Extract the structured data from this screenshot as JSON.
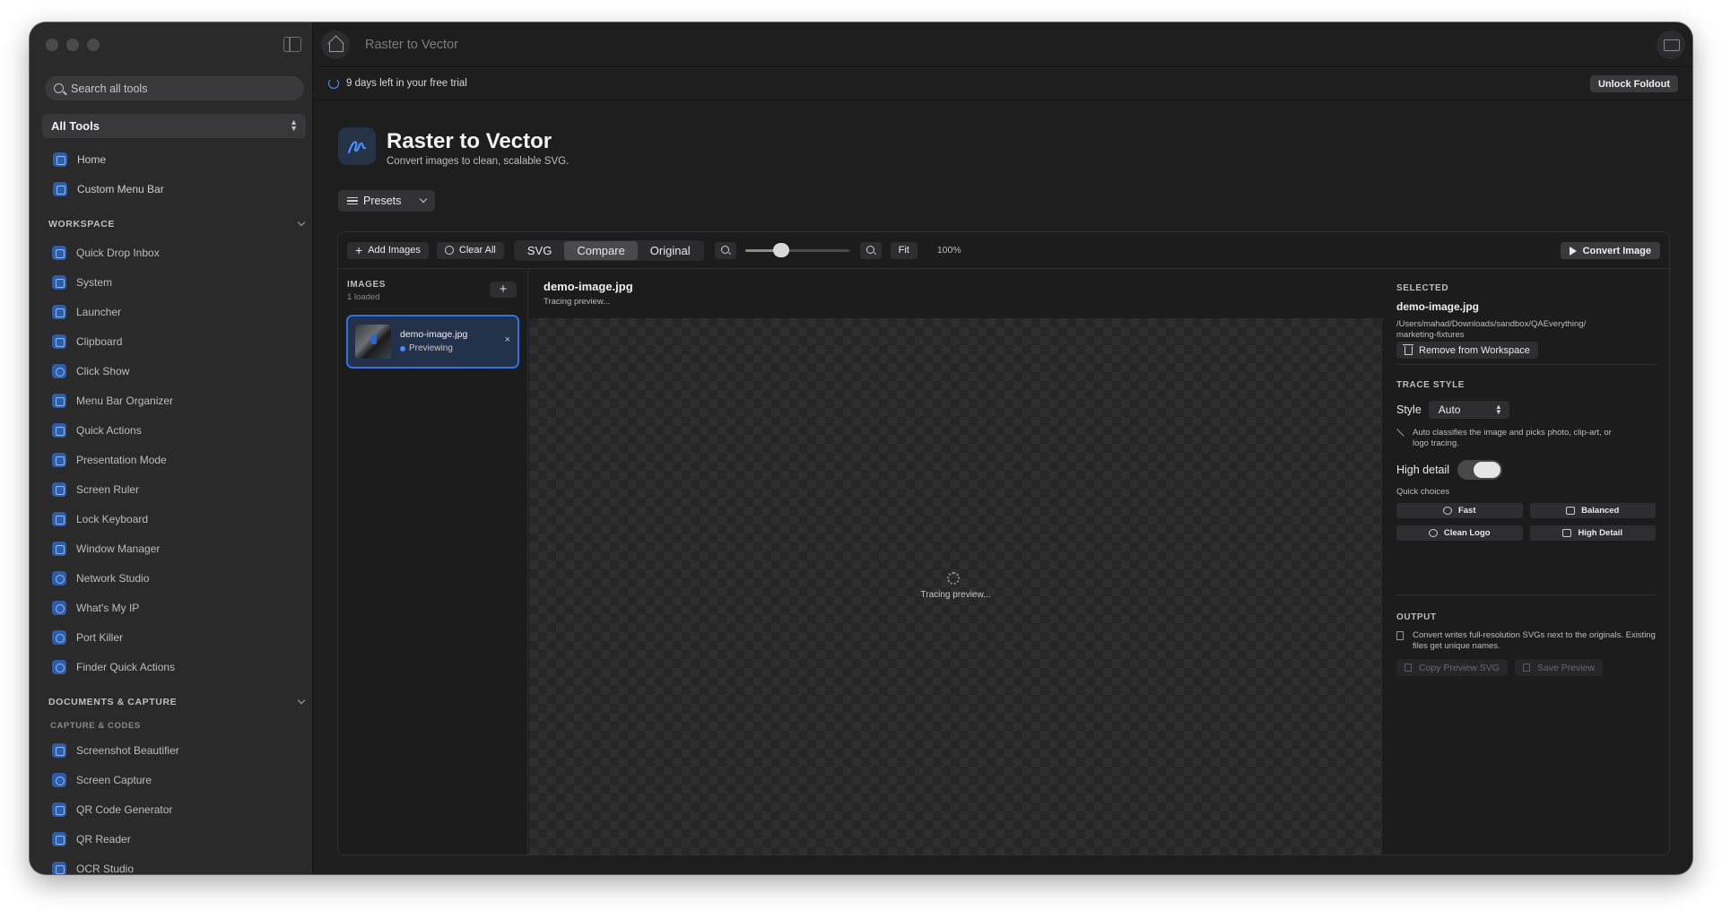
{
  "sidebar": {
    "search_placeholder": "Search all tools",
    "scope_select": "All Tools",
    "top_items": [
      {
        "label": "Home",
        "icon": "house-icon"
      },
      {
        "label": "Custom Menu Bar",
        "icon": "menubar-icon"
      }
    ],
    "workspace_title": "WORKSPACE",
    "workspace_items": [
      {
        "label": "Quick Drop Inbox",
        "icon": "tray-icon"
      },
      {
        "label": "System",
        "icon": "system-icon"
      },
      {
        "label": "Launcher",
        "icon": "command-icon"
      },
      {
        "label": "Clipboard",
        "icon": "clipboard-icon"
      },
      {
        "label": "Click Show",
        "icon": "cursor-click-icon"
      },
      {
        "label": "Menu Bar Organizer",
        "icon": "menubar-icon"
      },
      {
        "label": "Quick Actions",
        "icon": "bolt-icon"
      },
      {
        "label": "Presentation Mode",
        "icon": "presentation-icon"
      },
      {
        "label": "Screen Ruler",
        "icon": "ruler-icon"
      },
      {
        "label": "Lock Keyboard",
        "icon": "lock-icon"
      },
      {
        "label": "Window Manager",
        "icon": "windows-icon"
      },
      {
        "label": "Network Studio",
        "icon": "globe-icon"
      },
      {
        "label": "What's My IP",
        "icon": "globe-icon"
      },
      {
        "label": "Port Killer",
        "icon": "stop-icon"
      },
      {
        "label": "Finder Quick Actions",
        "icon": "sparkle-icon"
      }
    ],
    "documents_title": "DOCUMENTS & CAPTURE",
    "capture_subtitle": "CAPTURE & CODES",
    "capture_items": [
      {
        "label": "Screenshot Beautifier",
        "icon": "screenshot-icon"
      },
      {
        "label": "Screen Capture",
        "icon": "capture-icon"
      },
      {
        "label": "QR Code Generator",
        "icon": "qrcode-icon"
      },
      {
        "label": "QR Reader",
        "icon": "qrcode-scan-icon"
      },
      {
        "label": "OCR Studio",
        "icon": "text-scan-icon"
      }
    ]
  },
  "header": {
    "window_title": "Raster to Vector",
    "trial_text": "9 days left in your free trial",
    "unlock_label": "Unlock Foldout"
  },
  "tool": {
    "title": "Raster to Vector",
    "subtitle": "Convert images to clean, scalable SVG.",
    "presets_label": "Presets"
  },
  "toolbar": {
    "add_images": "Add Images",
    "clear_all": "Clear All",
    "view_modes": [
      "SVG",
      "Compare",
      "Original"
    ],
    "active_view": "Compare",
    "zoom_slider_fraction": 0.35,
    "fit_label": "Fit",
    "zoom_label": "100%",
    "convert_label": "Convert Image"
  },
  "images": {
    "title": "IMAGES",
    "count": "1 loaded",
    "add": "+",
    "items": [
      {
        "name": "demo-image.jpg",
        "status": "Previewing",
        "close": "×"
      }
    ]
  },
  "preview": {
    "filename": "demo-image.jpg",
    "status": "Tracing preview...",
    "center_status": "Tracing preview..."
  },
  "settings": {
    "selected_title": "SELECTED",
    "selected_name": "demo-image.jpg",
    "selected_path_line1": "/Users/mahad/Downloads/sandbox/QAEverything/",
    "selected_path_line2": "marketing-fixtures",
    "remove_label": "Remove from Workspace",
    "trace_title": "TRACE STYLE",
    "style_label": "Style",
    "style_value": "Auto",
    "auto_note": "Auto classifies the image and picks photo, clip-art, or logo tracing.",
    "high_detail_label": "High detail",
    "high_detail_on": true,
    "quick_title": "Quick choices",
    "quick_choices": [
      {
        "label": "Fast",
        "icon": "gauge-icon"
      },
      {
        "label": "Balanced",
        "icon": "sliders-icon"
      },
      {
        "label": "Clean Logo",
        "icon": "circle-icon"
      },
      {
        "label": "High Detail",
        "icon": "sparkle-icon"
      }
    ],
    "output_title": "OUTPUT",
    "output_note": "Convert writes full-resolution SVGs next to the originals. Existing files get unique names.",
    "copy_label": "Copy Preview SVG",
    "save_label": "Save Preview"
  },
  "colors": {
    "accent": "#2f72e0",
    "sidebar_bg": "#2a2a2b",
    "main_bg": "#1e1e1e"
  }
}
